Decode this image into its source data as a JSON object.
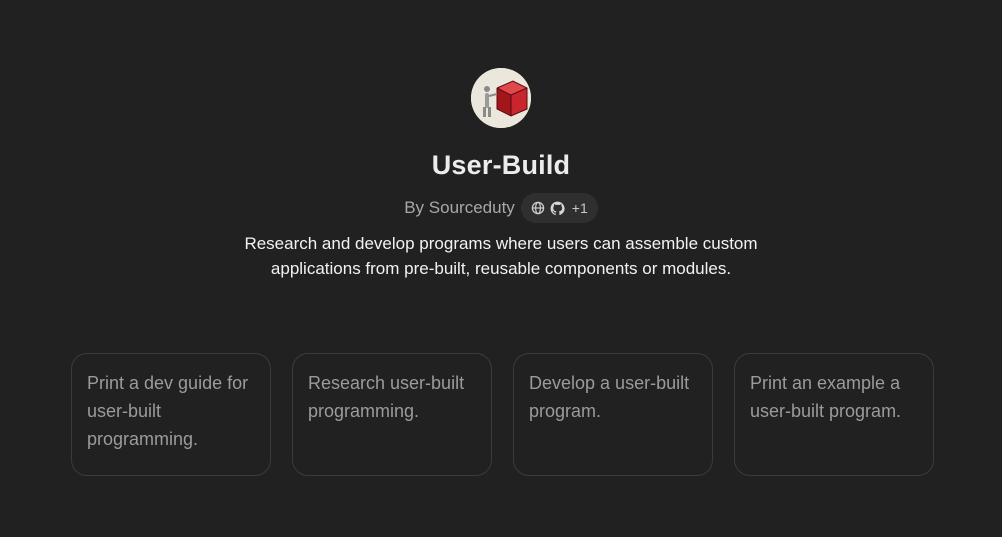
{
  "gpt": {
    "name": "User-Build",
    "author_prefix": "By",
    "author": "Sourceduty",
    "links": {
      "icons": [
        "globe-icon",
        "github-icon"
      ],
      "more_count": "+1"
    },
    "description": "Research and develop programs where users can assemble custom applications from pre-built, reusable components or modules."
  },
  "conversation_starters": [
    {
      "text": "Print a dev guide for user-built programming."
    },
    {
      "text": "Research user-built programming."
    },
    {
      "text": "Develop a user-built program."
    },
    {
      "text": "Print an example a user-built program."
    }
  ],
  "colors": {
    "background": "#212121",
    "card_border": "#3b3b3b",
    "pill_background": "#2f2f2f",
    "muted_text": "#a8a8a8",
    "avatar_cube": "#c0262b"
  }
}
